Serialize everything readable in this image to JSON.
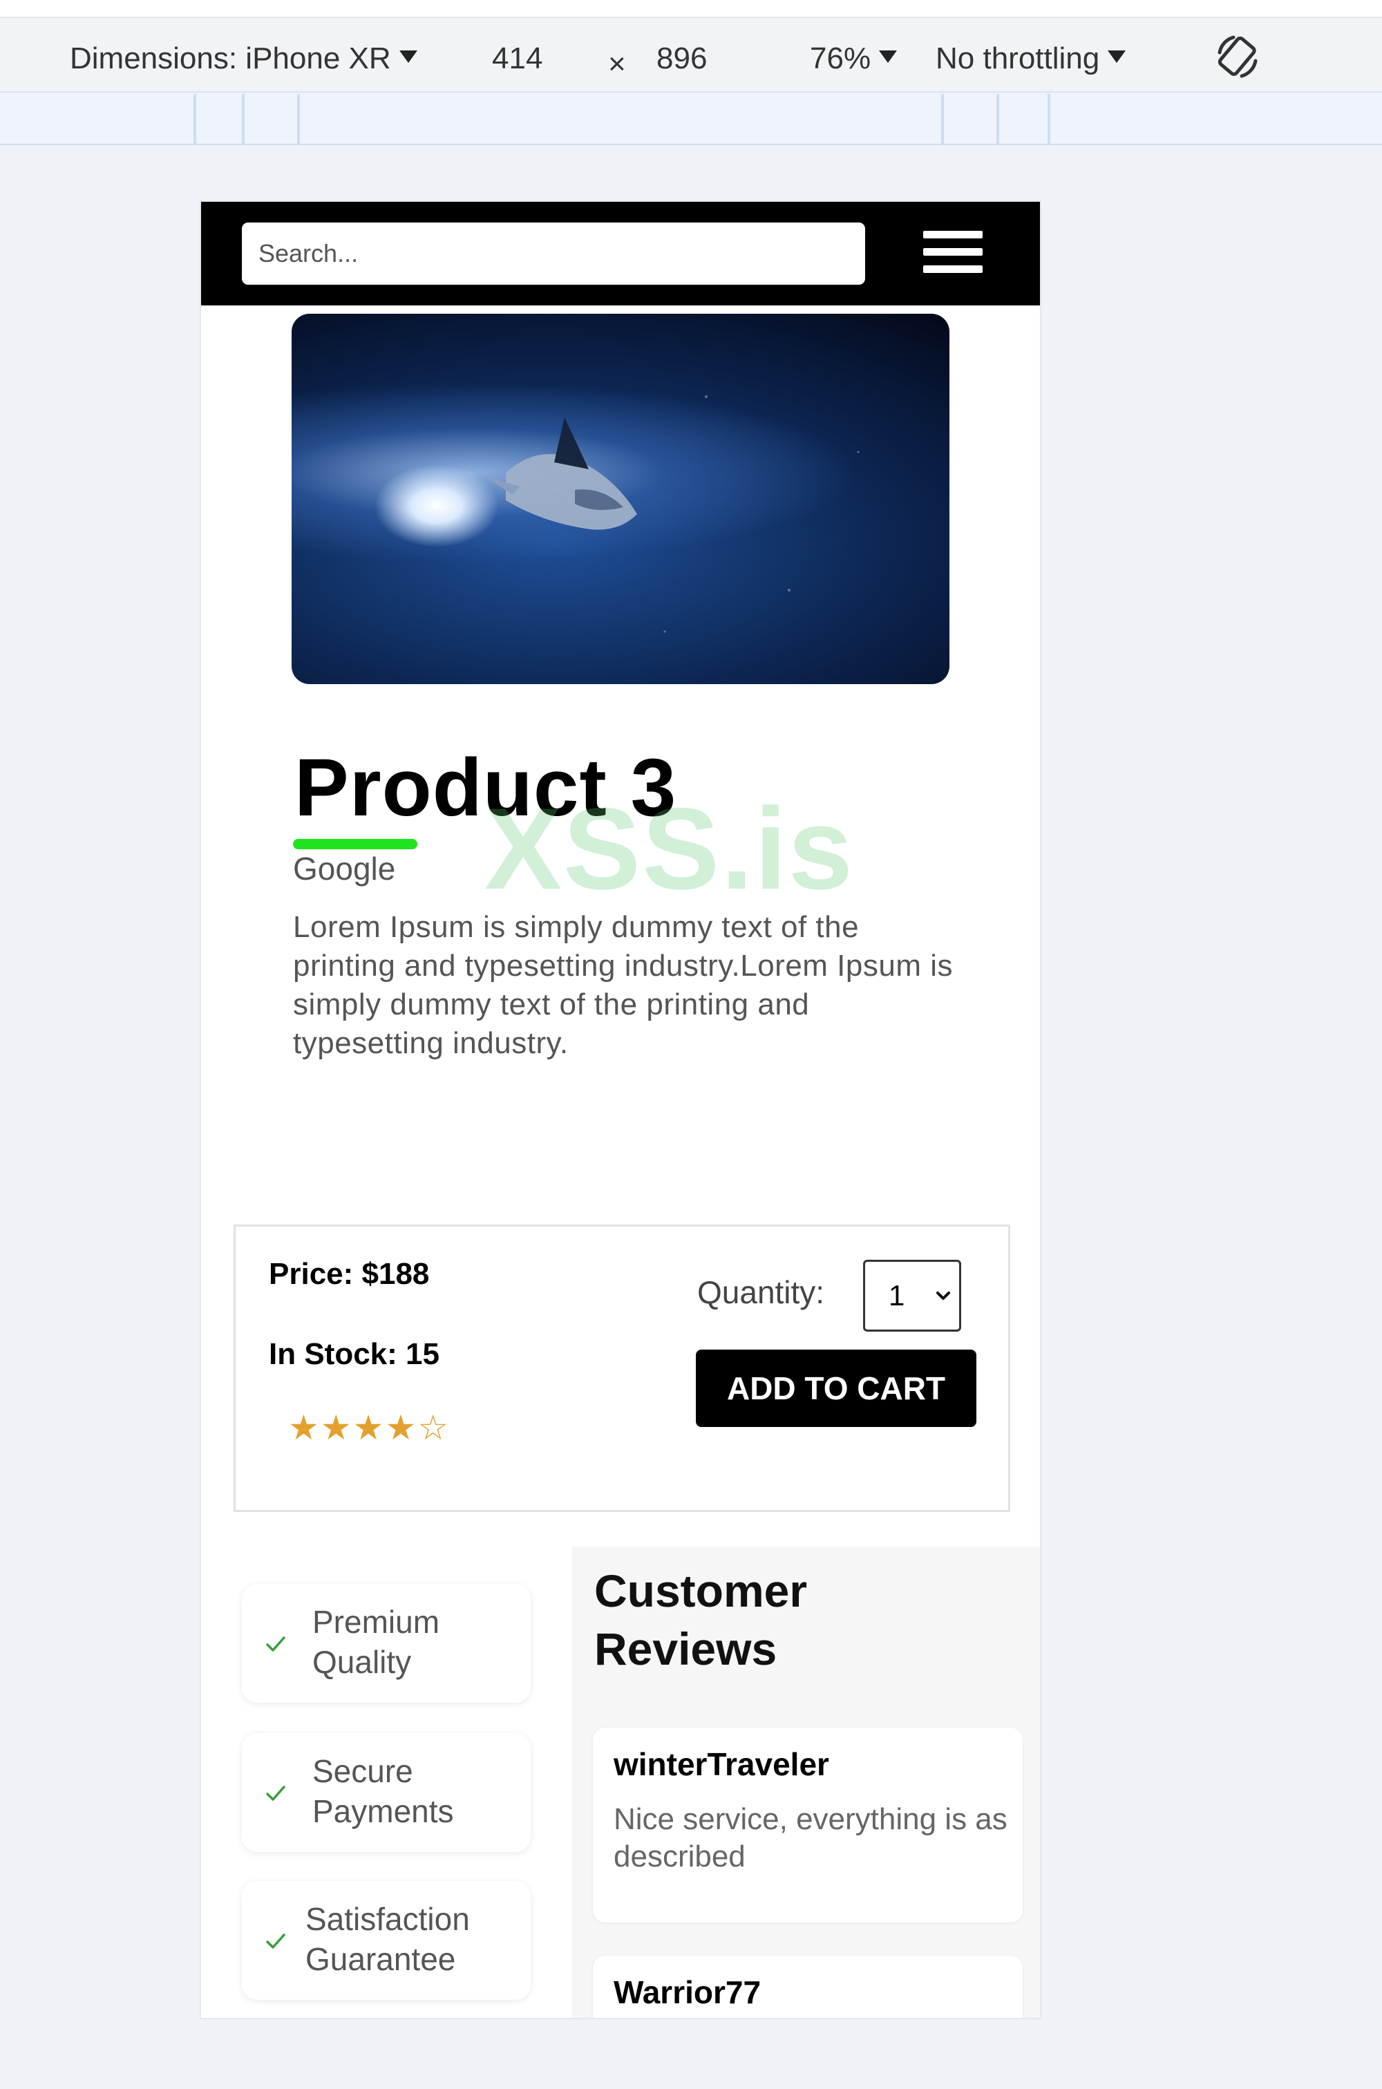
{
  "devtools": {
    "dimensions_label": "Dimensions: iPhone XR",
    "width": "414",
    "times": "×",
    "height": "896",
    "zoom": "76%",
    "throttling": "No throttling"
  },
  "navbar": {
    "search_placeholder": "Search..."
  },
  "product": {
    "title": "Product 3",
    "brand": "Google",
    "description": "Lorem Ipsum is simply dummy text of the printing and typesetting industry.Lorem Ipsum is simply dummy text of the printing and typesetting industry.",
    "price_label": "Price: $188",
    "stock_label": "In Stock: 15",
    "rating_stars": "★★★★☆",
    "rating_value": 4,
    "rating_max": 5,
    "quantity_label": "Quantity:",
    "quantity_value": "1",
    "add_to_cart": "ADD TO CART",
    "accent_color": "#1ee41e",
    "star_color": "#e4a02e"
  },
  "watermark": "XSS.is",
  "features": [
    {
      "label": "Premium Quality"
    },
    {
      "label": "Secure Payments"
    },
    {
      "label": "Satisfaction Guarantee"
    }
  ],
  "reviews": {
    "title": "Customer Reviews",
    "items": [
      {
        "author": "winterTraveler",
        "text": "Nice service, everything is as described"
      },
      {
        "author": "Warrior77",
        "text": ""
      }
    ]
  },
  "icons": {
    "menu": "hamburger-menu-icon",
    "rotate": "rotate-device-icon",
    "check": "check-icon",
    "dropdown": "chevron-down-icon"
  }
}
